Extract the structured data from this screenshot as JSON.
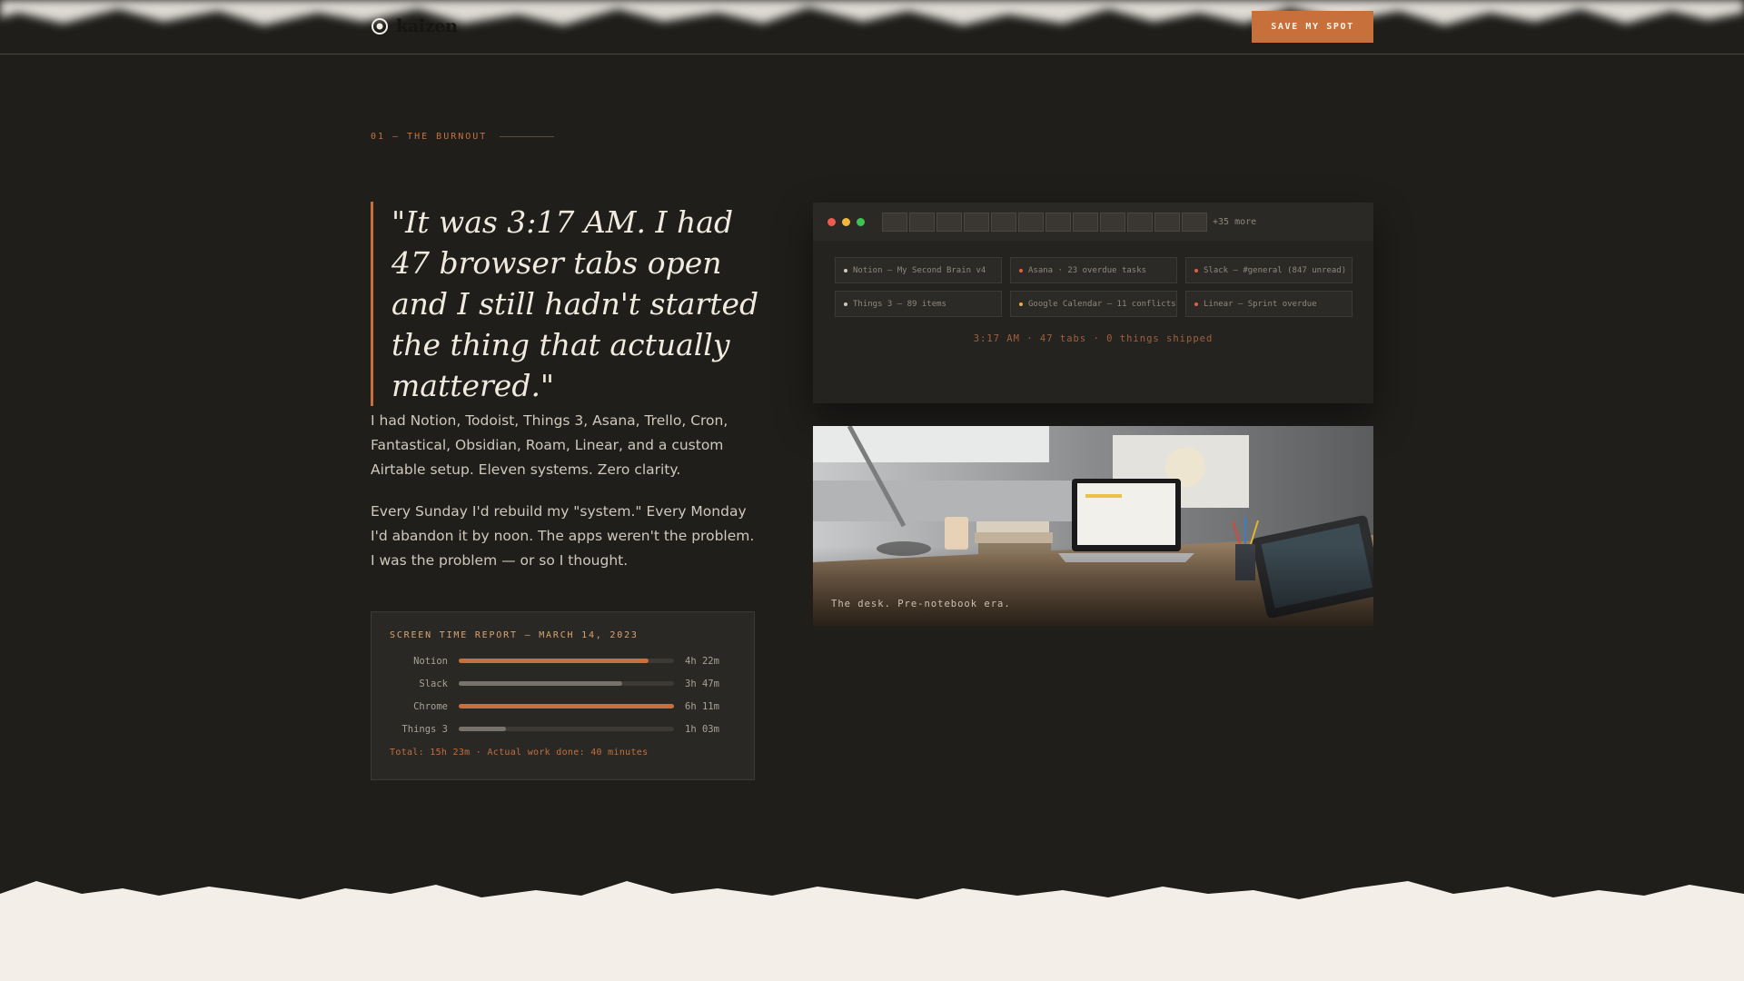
{
  "header": {
    "brand": "kaizen",
    "cta_label": "SAVE MY SPOT"
  },
  "section": {
    "label": "01 — THE BURNOUT"
  },
  "quote": "\"It was 3:17 AM. I had 47 browser tabs open and I still hadn't started the thing that actually mattered.\"",
  "paragraphs": [
    "I had Notion, Todoist, Things 3, Asana, Trello, Cron, Fantastical, Obsidian, Roam, Linear, and a custom Airtable setup. Eleven systems. Zero clarity.",
    "Every Sunday I'd rebuild my \"system.\" Every Monday I'd abandon it by noon. The apps weren't the problem. I was the problem — or so I thought."
  ],
  "report": {
    "title": "SCREEN TIME REPORT — MARCH 14, 2023",
    "rows": [
      {
        "app": "Notion",
        "time": "4h 22m",
        "fill": 0.88,
        "color": "#c8703b"
      },
      {
        "app": "Slack",
        "time": "3h 47m",
        "fill": 0.76,
        "color": "#77736b"
      },
      {
        "app": "Chrome",
        "time": "6h 11m",
        "fill": 1.0,
        "color": "#c8703b"
      },
      {
        "app": "Things 3",
        "time": "1h 03m",
        "fill": 0.22,
        "color": "#77736b"
      }
    ],
    "total": "Total: 15h 23m · Actual work done: 40 minutes"
  },
  "browser": {
    "more_tabs": "+35 more",
    "chips": [
      {
        "label": "Notion — My Second Brain v4",
        "dot_color": "#cfc8bb"
      },
      {
        "label": "Asana · 23 overdue tasks",
        "dot_color": "#e0603f"
      },
      {
        "label": "Slack — #general (847 unread)",
        "dot_color": "#e0603f"
      },
      {
        "label": "Things 3 — 89 items",
        "dot_color": "#cfc8bb"
      },
      {
        "label": "Google Calendar — 11 conflicts",
        "dot_color": "#e9b03a"
      },
      {
        "label": "Linear — Sprint overdue",
        "dot_color": "#e0603f"
      }
    ],
    "status": "3:17 AM · 47 tabs · 0 things shipped"
  },
  "photo": {
    "caption": "The desk. Pre-notebook era."
  },
  "colors": {
    "accent": "#c8703b",
    "background": "#1f1e1b",
    "paper": "#f3efe8"
  }
}
